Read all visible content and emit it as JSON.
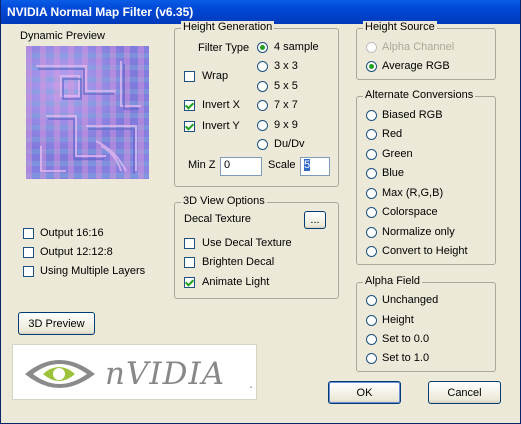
{
  "window": {
    "title": "NVIDIA Normal Map Filter (v6.35)"
  },
  "preview": {
    "label": "Dynamic Preview"
  },
  "left_options": [
    {
      "label": "Output 16:16",
      "checked": false
    },
    {
      "label": "Output 12:12:8",
      "checked": false
    },
    {
      "label": "Using Multiple Layers",
      "checked": false
    }
  ],
  "preview_button": "3D Preview",
  "logo": {
    "text": "nVIDIA",
    "mark": "."
  },
  "height_generation": {
    "title": "Height Generation",
    "filter_type_label": "Filter Type",
    "filter_types": [
      "4 sample",
      "3 x 3",
      "5 x 5",
      "7 x 7",
      "9 x 9",
      "Du/Dv"
    ],
    "selected_filter": "4 sample",
    "wrap_label": "Wrap",
    "invert_x_label": "Invert X",
    "invert_y_label": "Invert Y",
    "wrap": false,
    "invert_x": true,
    "invert_y": true,
    "min_z_label": "Min Z",
    "min_z": "0",
    "scale_label": "Scale",
    "scale": "5"
  },
  "view_options": {
    "title": "3D View Options",
    "decal_texture_label": "Decal Texture",
    "browse_label": "...",
    "use_decal_label": "Use Decal Texture",
    "brighten_label": "Brighten Decal",
    "animate_label": "Animate Light",
    "use_decal": false,
    "brighten": false,
    "animate": true
  },
  "height_source": {
    "title": "Height Source",
    "options": [
      "Alpha Channel",
      "Average RGB"
    ],
    "selected": "Average RGB",
    "disabled": [
      "Alpha Channel"
    ]
  },
  "alternate_conversions": {
    "title": "Alternate Conversions",
    "options": [
      "Biased RGB",
      "Red",
      "Green",
      "Blue",
      "Max (R,G,B)",
      "Colorspace",
      "Normalize only",
      "Convert to Height"
    ],
    "selected": ""
  },
  "alpha_field": {
    "title": "Alpha Field",
    "options": [
      "Unchanged",
      "Height",
      "Set to 0.0",
      "Set to 1.0"
    ],
    "selected": ""
  },
  "buttons": {
    "ok": "OK",
    "cancel": "Cancel"
  },
  "colors": {
    "titlebar": "#0a5ce6",
    "face": "#ece9d8",
    "check": "#21a121",
    "logo_green": "#76b900"
  }
}
